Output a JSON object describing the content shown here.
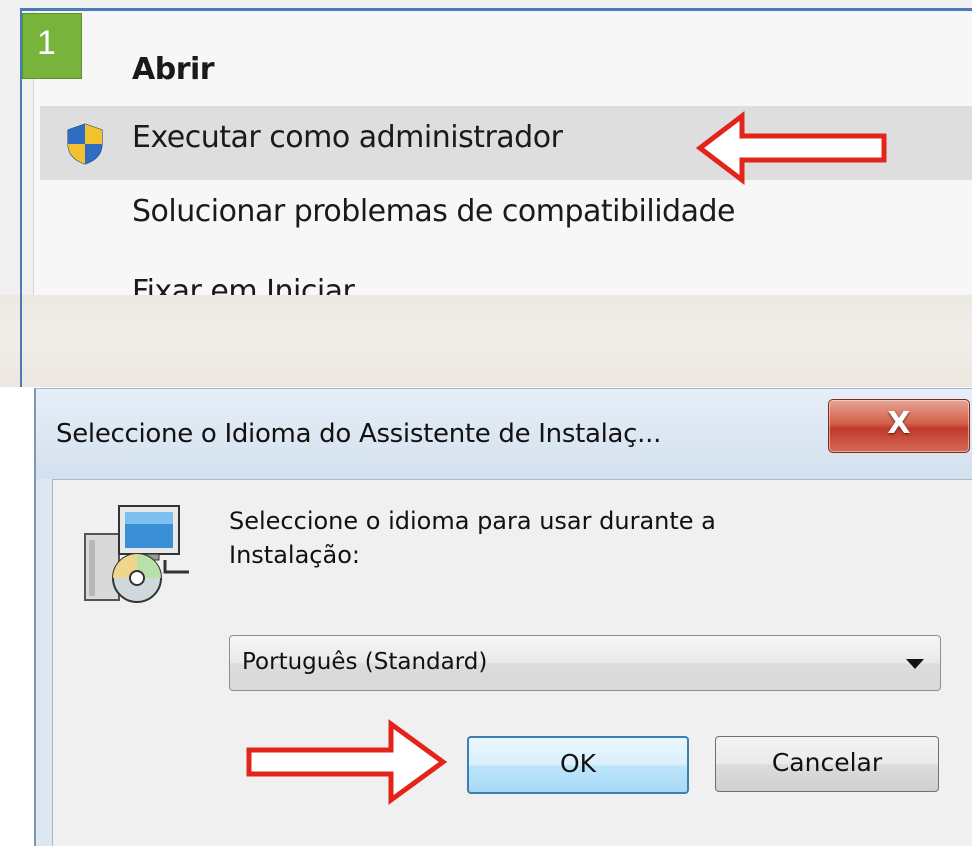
{
  "step_badge": "1",
  "context_menu": {
    "items": [
      {
        "label": "Abrir",
        "bold": true
      },
      {
        "label": "Executar como administrador",
        "highlighted": true,
        "icon": "uac-shield-icon"
      },
      {
        "label": "Solucionar problemas de compatibilidade"
      },
      {
        "label": "Fixar em Iniciar"
      }
    ]
  },
  "dialog": {
    "title": "Seleccione o Idioma do Assistente de Instalaç...",
    "close_label": "X",
    "prompt_line1": "Seleccione o idioma para usar durante a",
    "prompt_line2": "Instalação:",
    "language_select": {
      "value": "Português (Standard)"
    },
    "ok_label": "OK",
    "cancel_label": "Cancelar"
  },
  "annotations": {
    "arrow_color": "#e3241b",
    "badge_color": "#78b43c"
  }
}
